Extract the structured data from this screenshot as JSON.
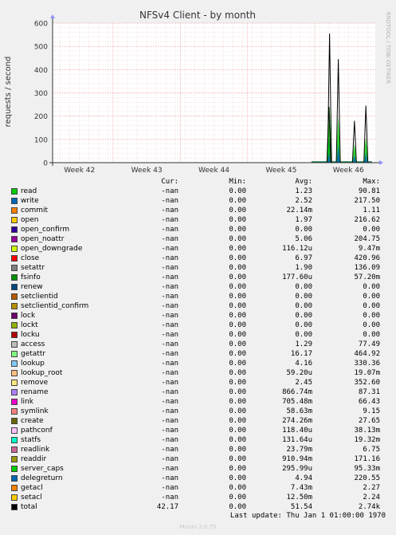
{
  "chart_data": {
    "type": "line",
    "title": "NFSv4 Client - by month",
    "ylabel": "requests / second",
    "side_label": "RRDTOOL / TOBI OETIKER",
    "ylim": [
      0,
      600
    ],
    "y_ticks": [
      0,
      100,
      200,
      300,
      400,
      500,
      600
    ],
    "x_ticks": [
      "Week 42",
      "Week 43",
      "Week 44",
      "Week 45",
      "Week 46"
    ],
    "x_range_weeks": [
      41.6,
      46.4
    ],
    "grid": true,
    "spikes": [
      {
        "x": 45.72,
        "y": 555
      },
      {
        "x": 45.85,
        "y": 445
      },
      {
        "x": 46.09,
        "y": 180
      },
      {
        "x": 46.26,
        "y": 245
      },
      {
        "x": 45.71,
        "y": 240
      }
    ],
    "legend_colors": [
      "#00cc00",
      "#0066b3",
      "#ff8000",
      "#ffcc00",
      "#330099",
      "#990099",
      "#ccff00",
      "#ff0000",
      "#808080",
      "#008f00",
      "#00487d",
      "#b35a00",
      "#b38f00",
      "#6b006b",
      "#8fb300",
      "#b30000",
      "#bebebe",
      "#80ff80",
      "#80c9ff",
      "#ffc080",
      "#ffe680",
      "#aa80ff",
      "#ee00cc",
      "#ff8080",
      "#666600",
      "#ffbfff",
      "#00ffcc",
      "#cc6699",
      "#999900",
      "#00cc00",
      "#0066b3",
      "#ff8000",
      "#ffcc00",
      "#000000"
    ]
  },
  "legend": {
    "headers": {
      "cur": "Cur:",
      "min": "Min:",
      "avg": "Avg:",
      "max": "Max:"
    },
    "rows": [
      {
        "name": "read",
        "cur": "-nan",
        "min": "0.00",
        "avg": "1.23",
        "max": "90.81"
      },
      {
        "name": "write",
        "cur": "-nan",
        "min": "0.00",
        "avg": "2.52",
        "max": "217.50"
      },
      {
        "name": "commit",
        "cur": "-nan",
        "min": "0.00",
        "avg": "22.14m",
        "max": "1.11"
      },
      {
        "name": "open",
        "cur": "-nan",
        "min": "0.00",
        "avg": "1.97",
        "max": "216.62"
      },
      {
        "name": "open_confirm",
        "cur": "-nan",
        "min": "0.00",
        "avg": "0.00",
        "max": "0.00"
      },
      {
        "name": "open_noattr",
        "cur": "-nan",
        "min": "0.00",
        "avg": "5.06",
        "max": "204.75"
      },
      {
        "name": "open_downgrade",
        "cur": "-nan",
        "min": "0.00",
        "avg": "116.12u",
        "max": "9.47m"
      },
      {
        "name": "close",
        "cur": "-nan",
        "min": "0.00",
        "avg": "6.97",
        "max": "420.96"
      },
      {
        "name": "setattr",
        "cur": "-nan",
        "min": "0.00",
        "avg": "1.90",
        "max": "136.09"
      },
      {
        "name": "fsinfo",
        "cur": "-nan",
        "min": "0.00",
        "avg": "177.60u",
        "max": "57.20m"
      },
      {
        "name": "renew",
        "cur": "-nan",
        "min": "0.00",
        "avg": "0.00",
        "max": "0.00"
      },
      {
        "name": "setclientid",
        "cur": "-nan",
        "min": "0.00",
        "avg": "0.00",
        "max": "0.00"
      },
      {
        "name": "setclientid_confirm",
        "cur": "-nan",
        "min": "0.00",
        "avg": "0.00",
        "max": "0.00"
      },
      {
        "name": "lock",
        "cur": "-nan",
        "min": "0.00",
        "avg": "0.00",
        "max": "0.00"
      },
      {
        "name": "lockt",
        "cur": "-nan",
        "min": "0.00",
        "avg": "0.00",
        "max": "0.00"
      },
      {
        "name": "locku",
        "cur": "-nan",
        "min": "0.00",
        "avg": "0.00",
        "max": "0.00"
      },
      {
        "name": "access",
        "cur": "-nan",
        "min": "0.00",
        "avg": "1.29",
        "max": "77.49"
      },
      {
        "name": "getattr",
        "cur": "-nan",
        "min": "0.00",
        "avg": "16.17",
        "max": "464.92"
      },
      {
        "name": "lookup",
        "cur": "-nan",
        "min": "0.00",
        "avg": "4.16",
        "max": "330.36"
      },
      {
        "name": "lookup_root",
        "cur": "-nan",
        "min": "0.00",
        "avg": "59.20u",
        "max": "19.07m"
      },
      {
        "name": "remove",
        "cur": "-nan",
        "min": "0.00",
        "avg": "2.45",
        "max": "352.60"
      },
      {
        "name": "rename",
        "cur": "-nan",
        "min": "0.00",
        "avg": "866.74m",
        "max": "87.31"
      },
      {
        "name": "link",
        "cur": "-nan",
        "min": "0.00",
        "avg": "705.48m",
        "max": "66.43"
      },
      {
        "name": "symlink",
        "cur": "-nan",
        "min": "0.00",
        "avg": "58.63m",
        "max": "9.15"
      },
      {
        "name": "create",
        "cur": "-nan",
        "min": "0.00",
        "avg": "274.26m",
        "max": "27.65"
      },
      {
        "name": "pathconf",
        "cur": "-nan",
        "min": "0.00",
        "avg": "118.40u",
        "max": "38.13m"
      },
      {
        "name": "statfs",
        "cur": "-nan",
        "min": "0.00",
        "avg": "131.64u",
        "max": "19.32m"
      },
      {
        "name": "readlink",
        "cur": "-nan",
        "min": "0.00",
        "avg": "23.79m",
        "max": "6.75"
      },
      {
        "name": "readdir",
        "cur": "-nan",
        "min": "0.00",
        "avg": "910.94m",
        "max": "171.16"
      },
      {
        "name": "server_caps",
        "cur": "-nan",
        "min": "0.00",
        "avg": "295.99u",
        "max": "95.33m"
      },
      {
        "name": "delegreturn",
        "cur": "-nan",
        "min": "0.00",
        "avg": "4.94",
        "max": "220.55"
      },
      {
        "name": "getacl",
        "cur": "-nan",
        "min": "0.00",
        "avg": "7.43m",
        "max": "2.27"
      },
      {
        "name": "setacl",
        "cur": "-nan",
        "min": "0.00",
        "avg": "12.50m",
        "max": "2.24"
      },
      {
        "name": "total",
        "cur": "42.17",
        "min": "0.00",
        "avg": "51.54",
        "max": "2.74k"
      }
    ]
  },
  "footer": {
    "last_update": "Last update: Thu Jan  1 01:00:00 1970",
    "munin": "Munin 2.0.75"
  }
}
